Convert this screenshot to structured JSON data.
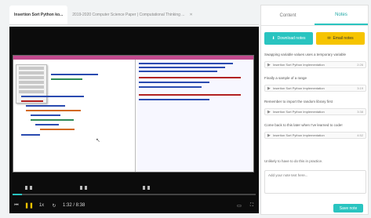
{
  "tabs": [
    {
      "label": "Insertion Sort Python ko...",
      "active": true
    },
    {
      "label": "2019-2020 Computer Science Paper | Computational Thinking ...",
      "active": false
    }
  ],
  "player": {
    "time": "1:32 / 8:38",
    "speed": "1x",
    "progress_fraction": 0.04
  },
  "panel": {
    "tabs": [
      "Content",
      "Notes"
    ],
    "active_tab": "Notes",
    "download_label": "Download notes",
    "email_label": "Email notes",
    "notes": [
      {
        "text": "Swapping variable values uses a temporary variable",
        "source": "Insertion Sort Python Implementation",
        "time": "2:26"
      },
      {
        "text": "Finally a sample of a range",
        "source": "Insertion Sort Python Implementation",
        "time": "3:19"
      },
      {
        "text": "Remember to import the random library first",
        "source": "Insertion Sort Python Implementation",
        "time": "3:38"
      },
      {
        "text": "Come back to this later when I've learned to code!",
        "source": "Insertion Sort Python Implementation",
        "time": "4:52"
      }
    ],
    "prompt": "Unlikely to have to do this in practice.",
    "input_placeholder": "Add your note text here...",
    "save_label": "Save note"
  },
  "colors": {
    "accent": "#29c4c0",
    "yellow": "#f6c400"
  }
}
